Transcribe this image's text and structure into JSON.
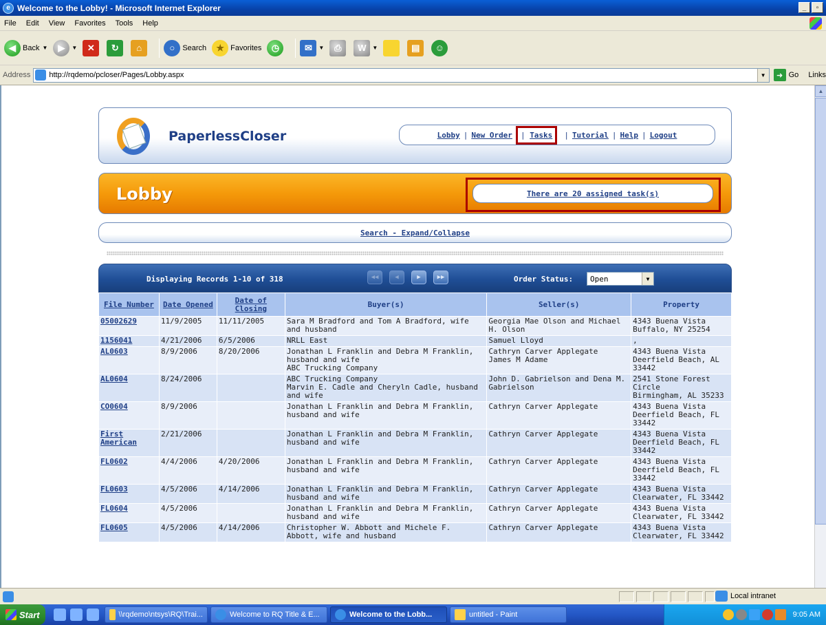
{
  "window": {
    "title": "Welcome to the Lobby! - Microsoft Internet Explorer"
  },
  "menu": [
    "File",
    "Edit",
    "View",
    "Favorites",
    "Tools",
    "Help"
  ],
  "toolbar": {
    "back": "Back",
    "search": "Search",
    "favorites": "Favorites"
  },
  "address": {
    "label": "Address",
    "url": "http://rqdemo/pcloser/Pages/Lobby.aspx",
    "go": "Go",
    "links": "Links"
  },
  "app": {
    "brand": "PaperlessCloser",
    "nav": [
      "Lobby",
      "New Order",
      "Tasks",
      "Tutorial",
      "Help",
      "Logout"
    ],
    "lobby_title": "Lobby",
    "tasks_link": "There are 20 assigned task(s)",
    "search_link": "Search - Expand/Collapse"
  },
  "grid": {
    "displaying": "Displaying Records 1-10 of 318",
    "order_status_label": "Order Status:",
    "order_status_value": "Open",
    "columns": [
      "File Number",
      "Date Opened",
      "Date of Closing",
      "Buyer(s)",
      "Seller(s)",
      "Property"
    ],
    "rows": [
      {
        "file": "05002629",
        "opened": "11/9/2005",
        "closing": "11/11/2005",
        "buyer": "Sara M Bradford and Tom A Bradford, wife and husband",
        "seller": "Georgia Mae Olson and Michael H. Olson",
        "property": "4343 Buena Vista Buffalo, NY 25254"
      },
      {
        "file": "1156041",
        "opened": "4/21/2006",
        "closing": "6/5/2006",
        "buyer": "NRLL East",
        "seller": "Samuel Lloyd",
        "property": ","
      },
      {
        "file": "AL0603",
        "opened": "8/9/2006",
        "closing": "8/20/2006",
        "buyer": "Jonathan L Franklin and Debra M Franklin, husband and wife\nABC Trucking Company",
        "seller": "Cathryn Carver Applegate\nJames M Adame",
        "property": "4343 Buena Vista Deerfield Beach, AL 33442"
      },
      {
        "file": "AL0604",
        "opened": "8/24/2006",
        "closing": "",
        "buyer": "ABC Trucking Company\nMarvin E. Cadle and Cheryln Cadle, husband and wife",
        "seller": "John D. Gabrielson and Dena M. Gabrielson",
        "property": "2541 Stone Forest Circle\nBirmingham, AL 35233"
      },
      {
        "file": "CO0604",
        "opened": "8/9/2006",
        "closing": "",
        "buyer": "Jonathan L Franklin and Debra M Franklin, husband and wife",
        "seller": "Cathryn Carver Applegate",
        "property": "4343 Buena Vista Deerfield Beach, FL 33442"
      },
      {
        "file": "First American",
        "opened": "2/21/2006",
        "closing": "",
        "buyer": "Jonathan L Franklin and Debra M Franklin, husband and wife",
        "seller": "Cathryn Carver Applegate",
        "property": "4343 Buena Vista Deerfield Beach, FL 33442"
      },
      {
        "file": "FL0602",
        "opened": "4/4/2006",
        "closing": "4/20/2006",
        "buyer": "Jonathan L Franklin and Debra M Franklin, husband and wife",
        "seller": "Cathryn Carver Applegate",
        "property": "4343 Buena Vista Deerfield Beach, FL 33442"
      },
      {
        "file": "FL0603",
        "opened": "4/5/2006",
        "closing": "4/14/2006",
        "buyer": "Jonathan L Franklin and Debra M Franklin, husband and wife",
        "seller": "Cathryn Carver Applegate",
        "property": "4343 Buena Vista Clearwater, FL 33442"
      },
      {
        "file": "FL0604",
        "opened": "4/5/2006",
        "closing": "",
        "buyer": "Jonathan L Franklin and Debra M Franklin, husband and wife",
        "seller": "Cathryn Carver Applegate",
        "property": "4343 Buena Vista Clearwater, FL 33442"
      },
      {
        "file": "FL0605",
        "opened": "4/5/2006",
        "closing": "4/14/2006",
        "buyer": "Christopher W. Abbott and Michele F. Abbott, wife and husband",
        "seller": "Cathryn Carver Applegate",
        "property": "4343 Buena Vista Clearwater, FL 33442"
      }
    ]
  },
  "status": {
    "zone": "Local intranet"
  },
  "taskbar": {
    "start": "Start",
    "buttons": [
      "\\\\rqdemo\\ntsys\\RQ\\Trai...",
      "Welcome to RQ Title & E...",
      "Welcome to the Lobb...",
      "untitled - Paint"
    ],
    "clock": "9:05 AM"
  }
}
